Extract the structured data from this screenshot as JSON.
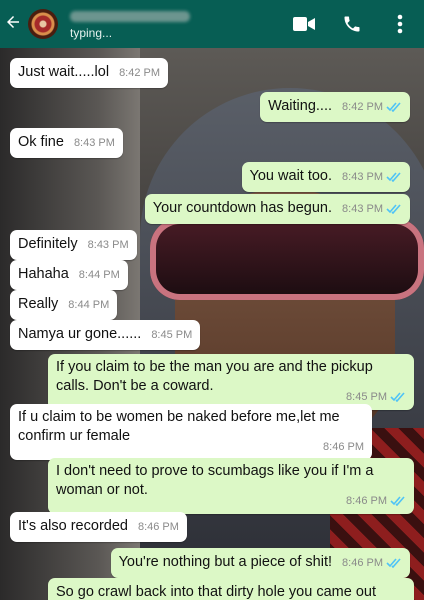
{
  "header": {
    "back_icon": "arrow-left-icon",
    "status": "typing...",
    "icons": [
      "video-call-icon",
      "phone-icon",
      "more-vertical-icon"
    ],
    "colors": {
      "bar": "#075e54",
      "outgoing": "#dcf8c6",
      "incoming": "#ffffff",
      "read_ticks": "#4fc3f7"
    }
  },
  "messages": [
    {
      "dir": "in",
      "text": "Just wait.....lol",
      "time": "8:42 PM"
    },
    {
      "dir": "out",
      "text": "Waiting....",
      "time": "8:42 PM",
      "ticks": "read"
    },
    {
      "dir": "in",
      "text": "Ok fine",
      "time": "8:43 PM"
    },
    {
      "dir": "out",
      "text": "You wait too.",
      "time": "8:43 PM",
      "ticks": "read"
    },
    {
      "dir": "out",
      "text": "Your countdown has begun.",
      "time": "8:43 PM",
      "ticks": "read"
    },
    {
      "dir": "in",
      "text": "Definitely",
      "time": "8:43 PM"
    },
    {
      "dir": "in",
      "text": "Hahaha",
      "time": "8:44 PM"
    },
    {
      "dir": "in",
      "text": "Really",
      "time": "8:44 PM"
    },
    {
      "dir": "in",
      "text": "Namya ur gone......",
      "time": "8:45 PM"
    },
    {
      "dir": "out",
      "text": "If you claim to be the man you are and the pickup calls. Don't be a coward.",
      "time": "8:45 PM",
      "ticks": "read"
    },
    {
      "dir": "in",
      "text": "If u claim to be women be naked before me,let me confirm ur female",
      "time": "8:46 PM"
    },
    {
      "dir": "out",
      "text": "I don't need to prove to scumbags like you if I'm a woman or not.",
      "time": "8:46 PM",
      "ticks": "read"
    },
    {
      "dir": "in",
      "text": "It's also recorded",
      "time": "8:46 PM"
    },
    {
      "dir": "out",
      "text": "You're nothing but a piece of shit!",
      "time": "8:46 PM",
      "ticks": "read"
    },
    {
      "dir": "out",
      "text": "So go crawl back into that dirty hole you came out",
      "time": ""
    }
  ]
}
